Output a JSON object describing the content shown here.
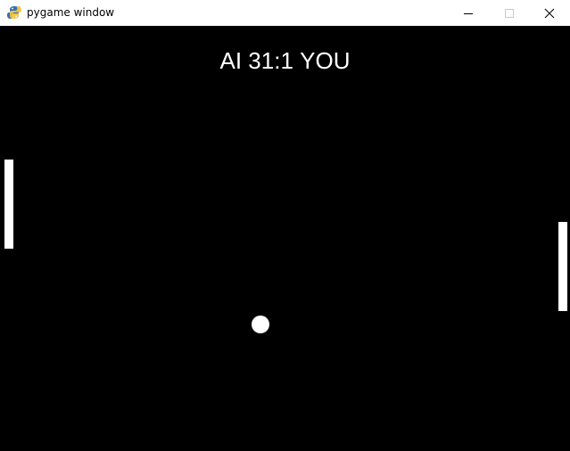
{
  "window": {
    "title": "pygame window",
    "icon": "pygame-snake-icon"
  },
  "controls": {
    "minimize_icon": "minimize-icon",
    "maximize_icon": "maximize-icon",
    "close_icon": "close-icon"
  },
  "score": {
    "left_label": "AI",
    "left_score": "31",
    "separator": ":",
    "right_score": "1",
    "right_label": "YOU"
  },
  "colors": {
    "background": "#000000",
    "foreground": "#ffffff",
    "titlebar": "#ffffff"
  }
}
